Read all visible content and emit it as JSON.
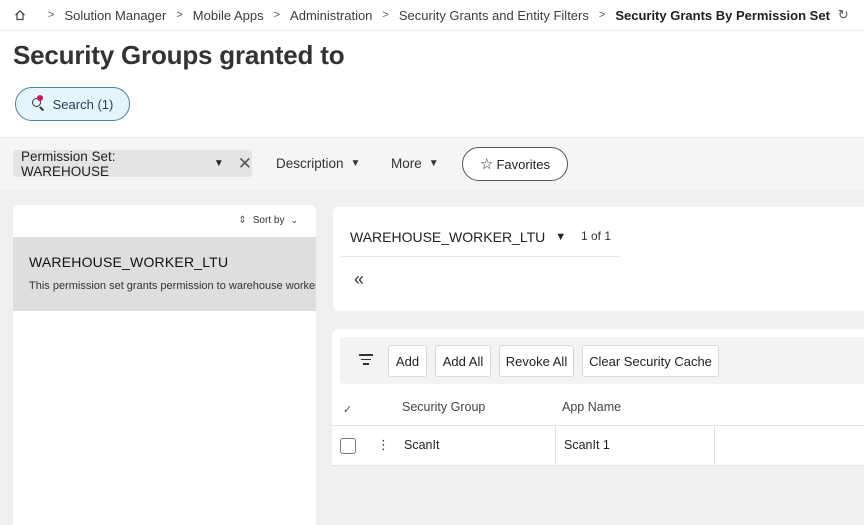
{
  "breadcrumb": {
    "items": [
      "Solution Manager",
      "Mobile Apps",
      "Administration",
      "Security Grants and Entity Filters"
    ],
    "current": "Security Grants By Permission Set"
  },
  "page": {
    "title": "Security Groups granted to"
  },
  "search": {
    "label": "Search (1)"
  },
  "filter_bar": {
    "chip_label": "Permission Set: WAREHOUSE",
    "description_label": "Description",
    "more_label": "More",
    "favorites_label": "Favorites"
  },
  "list": {
    "sort_label": "Sort by",
    "items": [
      {
        "name": "WAREHOUSE_WORKER_LTU",
        "description": "This permission set grants permission to warehouse workers"
      }
    ]
  },
  "detail": {
    "record_name": "WAREHOUSE_WORKER_LTU",
    "record_count": "1 of 1"
  },
  "grid": {
    "toolbar": {
      "add_label": "Add",
      "add_all_label": "Add All",
      "revoke_all_label": "Revoke All",
      "clear_cache_label": "Clear Security Cache"
    },
    "columns": [
      "Security Group",
      "App Name"
    ],
    "rows": [
      {
        "security_group": "ScanIt",
        "app_name": "ScanIt 1"
      }
    ]
  }
}
